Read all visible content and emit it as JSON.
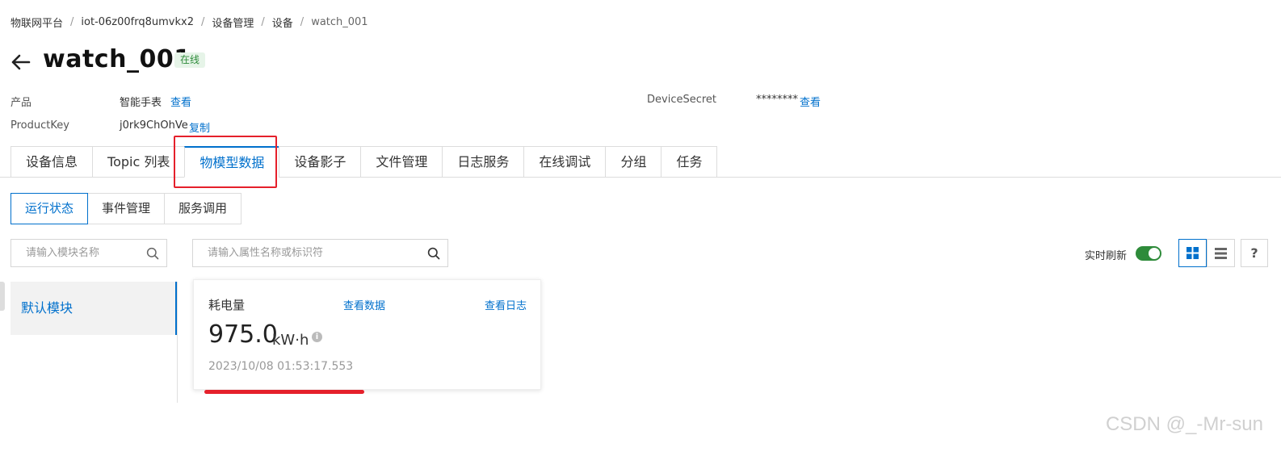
{
  "breadcrumb": [
    "物联网平台",
    "iot-06z00frq8umvkx2",
    "设备管理",
    "设备",
    "watch_001"
  ],
  "device": {
    "name": "watch_001",
    "status": "在线"
  },
  "info": {
    "product_label": "产品",
    "product_value": "智能手表",
    "product_link": "查看",
    "productkey_label": "ProductKey",
    "productkey_value": "j0rk9ChOhVe",
    "productkey_link": "复制",
    "secret_label": "DeviceSecret",
    "secret_value": "********",
    "secret_link": "查看"
  },
  "main_tabs": [
    "设备信息",
    "Topic 列表",
    "物模型数据",
    "设备影子",
    "文件管理",
    "日志服务",
    "在线调试",
    "分组",
    "任务"
  ],
  "main_tabs_active": "物模型数据",
  "sub_tabs": [
    "运行状态",
    "事件管理",
    "服务调用"
  ],
  "sub_tabs_active": "运行状态",
  "module_search": {
    "placeholder": "请输入模块名称"
  },
  "property_search": {
    "placeholder": "请输入属性名称或标识符"
  },
  "modules": [
    "默认模块"
  ],
  "property_card": {
    "name": "耗电量",
    "view_data": "查看数据",
    "view_log": "查看日志",
    "value": "975.0",
    "unit": "kW·h",
    "timestamp": "2023/10/08 01:53:17.553"
  },
  "toolbar": {
    "refresh_label": "实时刷新",
    "refresh_on": true,
    "help": "?"
  },
  "watermark": "CSDN @_-Mr-sun",
  "colors": {
    "accent": "#0070cc",
    "highlight": "#e5202b",
    "online": "#2e8b3a"
  }
}
